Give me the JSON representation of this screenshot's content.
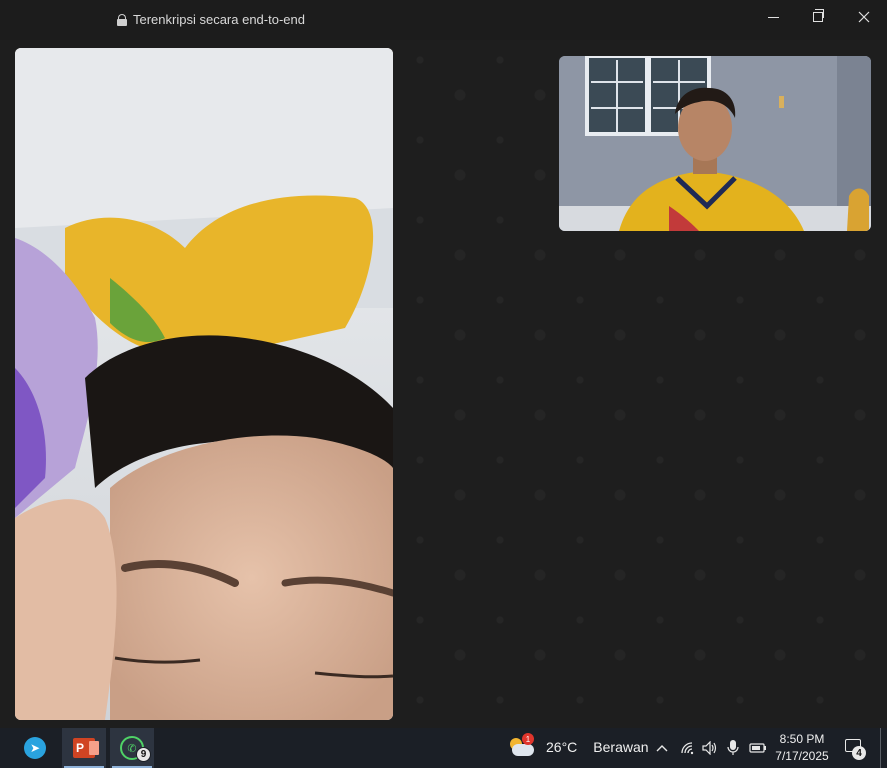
{
  "window": {
    "encryption_text": "Terenkripsi secara end-to-end"
  },
  "taskbar": {
    "apps": [
      {
        "name": "Telegram",
        "icon": "telegram-icon"
      },
      {
        "name": "PowerPoint",
        "icon": "powerpoint-icon",
        "label": "P"
      },
      {
        "name": "WhatsApp",
        "icon": "whatsapp-icon",
        "badge": "9"
      }
    ],
    "weather": {
      "temperature": "26°C",
      "condition": "Berawan",
      "alert_badge": "1"
    },
    "clock": {
      "time": "8:50 PM",
      "date": "7/17/2025"
    },
    "notifications_badge": "4"
  },
  "colors": {
    "background": "#1e1e1e",
    "taskbar": "#1b1f26",
    "whatsapp_green": "#4fd266",
    "telegram_blue": "#2aa3df",
    "powerpoint_red": "#d04423"
  }
}
